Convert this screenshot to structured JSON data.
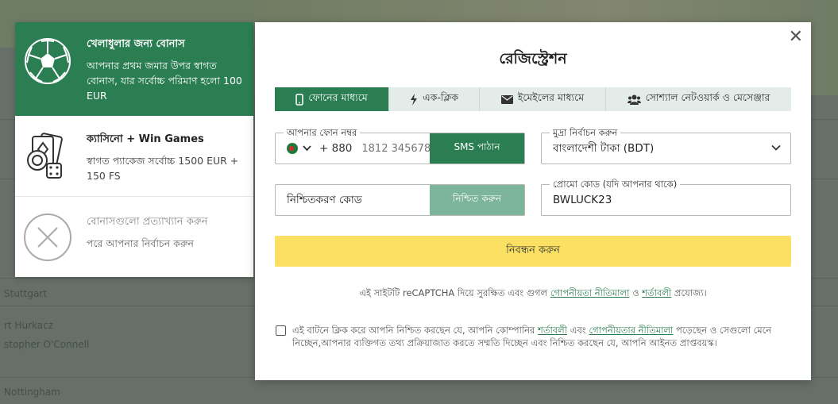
{
  "background": {
    "rows": [
      "Stuttgart",
      "rt Hurkacz",
      "stopher O'Connell",
      "Nottingham"
    ]
  },
  "bonus_panel": {
    "items": [
      {
        "title": "খেলাধুলার জন্য বোনাস",
        "desc": "আপনার প্রথম জমার উপর স্বাগত বোনাস, যার সর্বোচ্চ পরিমাণ হলো 100 EUR",
        "icon": "soccer-ball-icon"
      },
      {
        "title": "ক্যাসিনো + Win Games",
        "desc": "স্বাগত প্যাকেজ সর্বোচ্চ 1500 EUR + 150 FS",
        "icon": "casino-cards-icon"
      },
      {
        "title": "বোনাসগুলো প্রত্যাখ্যান করুন",
        "desc": "পরে আপনার নির্বাচন করুন",
        "icon": "decline-x-icon"
      }
    ]
  },
  "modal": {
    "title": "রেজিস্ট্রেশন",
    "close_label": "✕",
    "tabs": [
      {
        "label": "ফোনের মাধ্যমে",
        "icon": "phone-icon",
        "active": true
      },
      {
        "label": "এক-ক্লিক",
        "icon": "lightning-icon",
        "active": false
      },
      {
        "label": "ইমেইলের মাধ্যমে",
        "icon": "envelope-icon",
        "active": false
      },
      {
        "label": "সোশ্যাল নেটওয়ার্ক ও মেসেঞ্জার",
        "icon": "users-icon",
        "active": false
      }
    ],
    "phone": {
      "label": "আপনার ফোন নম্বর",
      "prefix": "+ 880",
      "placeholder": "1812 345678",
      "value": "",
      "sms_button": "SMS পাঠান"
    },
    "currency": {
      "label": "মুদ্রা নির্বাচন করুন",
      "value": "বাংলাদেশী টাকা (BDT)"
    },
    "confirmation": {
      "placeholder": "নিশ্চিতকরণ কোড",
      "button": "নিশ্চিত করুন"
    },
    "promo": {
      "label": "প্রোমো কোড (যদি আপনার থাকে)",
      "value": "BWLUCK23"
    },
    "register_button": "নিবন্ধন করুন",
    "recaptcha": {
      "prefix": "এই সাইটটি reCAPTCHA দিয়ে সুরক্ষিত এবং গুগল",
      "privacy_link": "গোপনীয়তা নীতিমালা",
      "and": "ও",
      "terms_link": "শর্তাবলী",
      "suffix": "প্রযোজ্য।"
    },
    "consent": {
      "part1": "এই বাটনে ক্লিক করে আপনি নিশ্চিত করছেন যে, আপনি কোম্পানির",
      "terms_link": "শর্তাবলী",
      "part2": "এবং",
      "privacy_link": "গোপনীয়তার নীতিমালা",
      "part3": "পড়েছেন ও সেগুলো মেনে নিচ্ছেন,আপনার ব্যক্তিগত তথ্য প্রক্রিয়াজাত করতে সম্মতি দিচ্ছেন এবং নিশ্চিত করছেন যে, আপনি আইনত প্রাপ্তবয়স্ক।"
    }
  },
  "colors": {
    "brand_green": "#2b7e52",
    "confirm_green": "#7db59a",
    "register_yellow": "#fbe063"
  }
}
